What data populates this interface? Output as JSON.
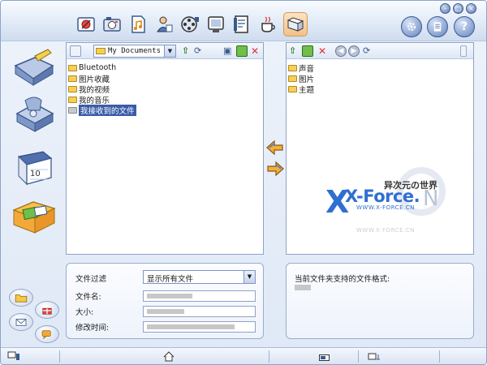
{
  "left_panel": {
    "location": "My Documents",
    "items": [
      {
        "label": "Bluetooth",
        "selected": false
      },
      {
        "label": "图片收藏",
        "selected": false
      },
      {
        "label": "我的视频",
        "selected": false
      },
      {
        "label": "我的音乐",
        "selected": false
      },
      {
        "label": "我接收到的文件",
        "selected": true
      }
    ]
  },
  "right_panel": {
    "items": [
      {
        "label": "声音"
      },
      {
        "label": "图片"
      },
      {
        "label": "主题"
      }
    ]
  },
  "logo": {
    "main": "X-Force.",
    "n": "N",
    "cn": "异次元の世界",
    "url": "WWW.X-FORCE.CN",
    "reflection": "WWW.X-FORCE.CN"
  },
  "file_info": {
    "filter_label": "文件过滤",
    "filter_value": "显示所有文件",
    "name_label": "文件名:",
    "size_label": "大小:",
    "modified_label": "修改时间:"
  },
  "format_info": {
    "label": "当前文件夹支持的文件格式:"
  },
  "colors": {
    "accent": "#3a5ca8",
    "window_bg": "#dfe8f6",
    "logo_blue": "#2f6fd1"
  }
}
